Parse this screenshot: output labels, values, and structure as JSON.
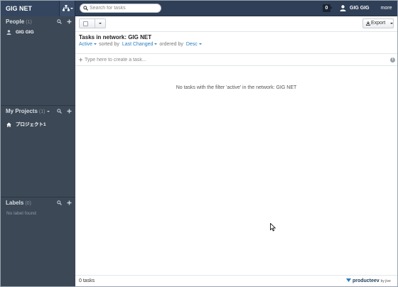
{
  "topbar": {
    "network_name": "GIG NET",
    "search_placeholder": "Search for tasks",
    "notification_count": "0",
    "user_name": "GIG GIG",
    "more_label": "more"
  },
  "sidebar": {
    "people": {
      "title": "People",
      "count": "(1)",
      "items": [
        {
          "label": "GIG GIG",
          "icon": "user-icon"
        }
      ]
    },
    "projects": {
      "title": "My Projects",
      "count": "(1)",
      "items": [
        {
          "label": "プロジェクト1",
          "icon": "home-icon"
        }
      ]
    },
    "labels": {
      "title": "Labels",
      "count": "(0)",
      "empty_text": "No label found"
    }
  },
  "main": {
    "export_label": "Export",
    "title": "Tasks in network: GIG NET",
    "filters": {
      "status": "Active",
      "sorted_by_text": "sorted by",
      "sort_field": "Last Changed",
      "ordered_by_text": "ordered by",
      "order": "Desc"
    },
    "new_task_placeholder": "Type here to create a task...",
    "empty_message": "No tasks with the filter 'active' in the network: GIG NET",
    "footer_count": "0 tasks",
    "brand": "producteev",
    "brand_by": "by jive"
  },
  "colors": {
    "topbar": "#2f3f57",
    "sidebar": "#3c4856",
    "link": "#2a7fc1"
  }
}
